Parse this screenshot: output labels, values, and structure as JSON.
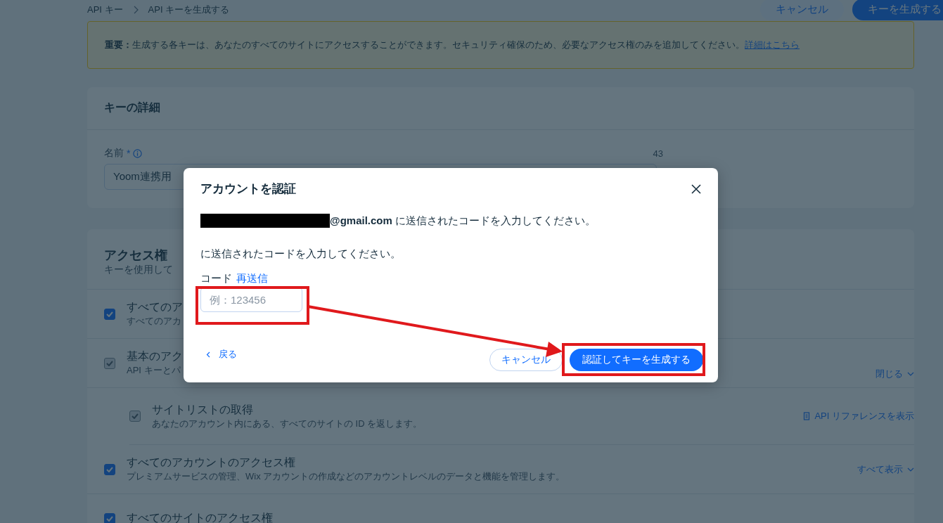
{
  "breadcrumb": [
    {
      "label": "API キー"
    },
    {
      "label": "API キーを生成する"
    }
  ],
  "header_buttons": [
    {
      "label": "キャンセル",
      "kind": "secondary"
    },
    {
      "label": "キーを生成する",
      "kind": "primary"
    }
  ],
  "notice": {
    "text": "**重要：**生成する各キーは、あなたのすべてのサイトにアクセスすることができます。セキュリティ確保のため、必要なアクセス権のみを追加してください。",
    "link": "詳細はこちら"
  },
  "key_details": {
    "title": "キーの詳細",
    "name_label": "名前",
    "required": "*",
    "counter": "43",
    "value": "Yoom連携用"
  },
  "access": {
    "title": "アクセス権",
    "subtitle": "キーを使用して",
    "rows": [
      {
        "title": "すべてのア",
        "description": "すべてのアカ",
        "checked": true,
        "disabled": false
      },
      {
        "title": "基本のアク",
        "description": "API キーとパ",
        "checked": true,
        "disabled": true,
        "action": "閉じる",
        "children": [
          {
            "title": "サイトリストの取得",
            "description": "あなたのアカウント内にある、すべてのサイトの ID を返します。",
            "checked": true,
            "disabled": true,
            "action": "API リファレンスを表示"
          }
        ]
      },
      {
        "title": "すべてのアカウントのアクセス権",
        "description": "プレミアムサービスの管理、Wix アカウントの作成などのアカウントレベルのデータと機能を管理します。",
        "checked": true,
        "disabled": false,
        "action": "すべて表示"
      },
      {
        "title": "すべてのサイトのアクセス権",
        "checked": true,
        "disabled": false
      }
    ]
  },
  "dialog": {
    "title": "アカウントを認証",
    "email_message": "**@gmail.com** に送信されたコードを入力してください。",
    "message": "に送信されたコードを入力してください。",
    "code_label": "コード",
    "resend": "再送信",
    "code_placeholder": "例：123456",
    "back": "戻る",
    "cancel": "キャンセル",
    "confirm": "認証してキーを生成する"
  }
}
